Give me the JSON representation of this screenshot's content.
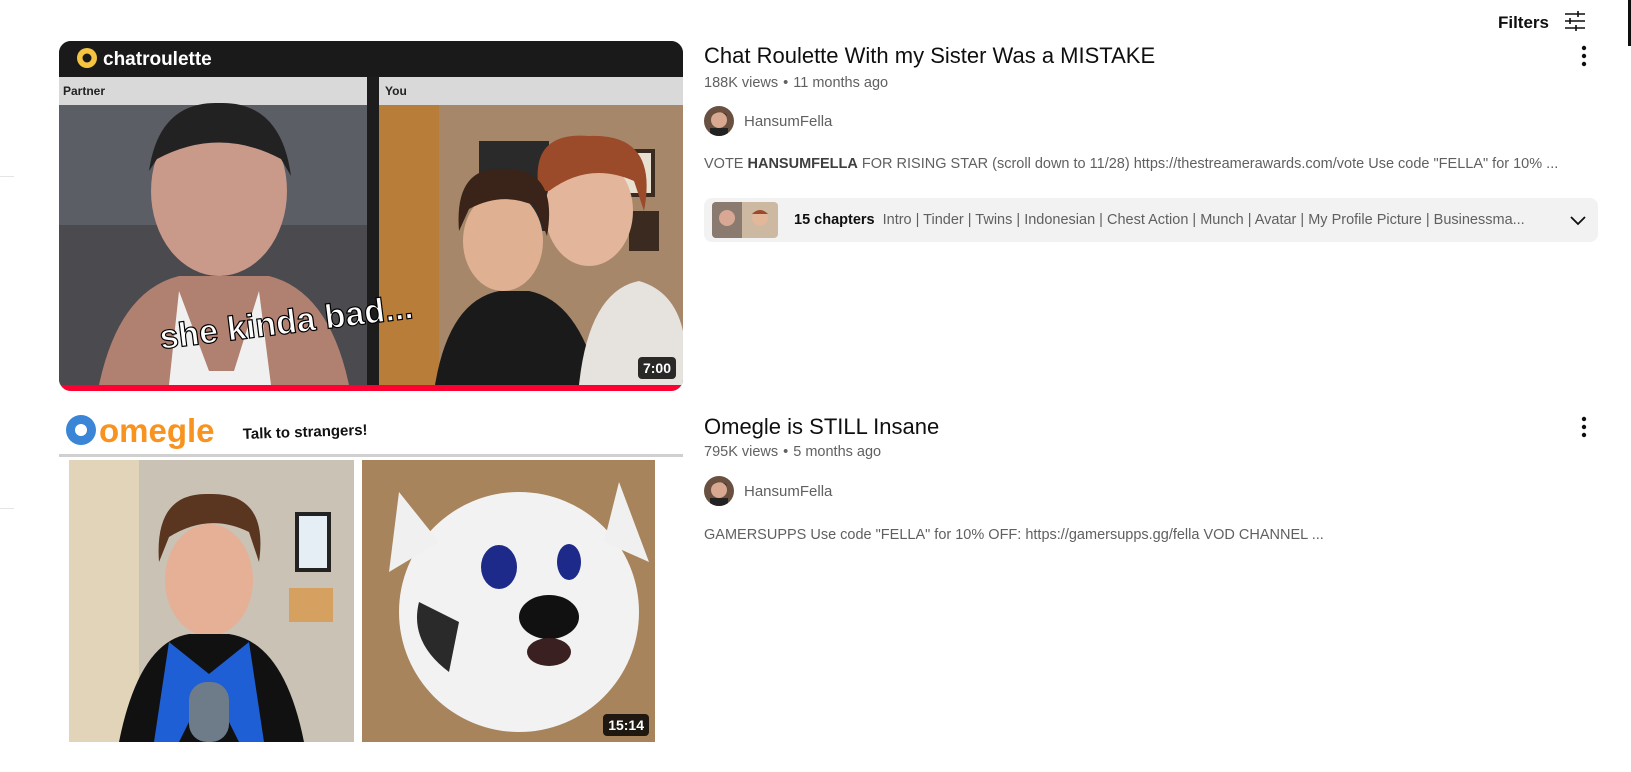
{
  "header": {
    "filters_label": "Filters",
    "filters_icon": "tune-icon"
  },
  "videos": [
    {
      "title": "Chat Roulette With my Sister Was a MISTAKE",
      "views": "188K views",
      "age": "11 months ago",
      "channel": "HansumFella",
      "description_pre": "VOTE ",
      "description_bold": "HANSUMFELLA",
      "description_post": " FOR RISING STAR (scroll down to 11/28) https://thestreamerawards.com/vote Use code \"FELLA\" for 10% ...",
      "chapters_count": "15 chapters",
      "chapters_list": "Intro | Tinder | Twins | Indonesian | Chest Action | Munch | Avatar | My Profile Picture | Businessma...",
      "duration": "7:00",
      "watch_progress": 1.0,
      "thumb": {
        "brand": "chatroulette",
        "left_label": "Partner",
        "right_label": "You",
        "caption": "she kinda bad..."
      }
    },
    {
      "title": "Omegle is STILL Insane",
      "views": "795K views",
      "age": "5 months ago",
      "channel": "HansumFella",
      "description": "GAMERSUPPS Use code \"FELLA\" for 10% OFF: https://gamersupps.gg/fella VOD CHANNEL ...",
      "duration": "15:14",
      "thumb": {
        "brand": "omegle",
        "tagline": "Talk to strangers!"
      }
    }
  ],
  "colors": {
    "progress": "#ff0033",
    "omegle_orange": "#f7931e",
    "omegle_blue": "#3a85d6",
    "chatroulette_yellow": "#f5c542"
  }
}
